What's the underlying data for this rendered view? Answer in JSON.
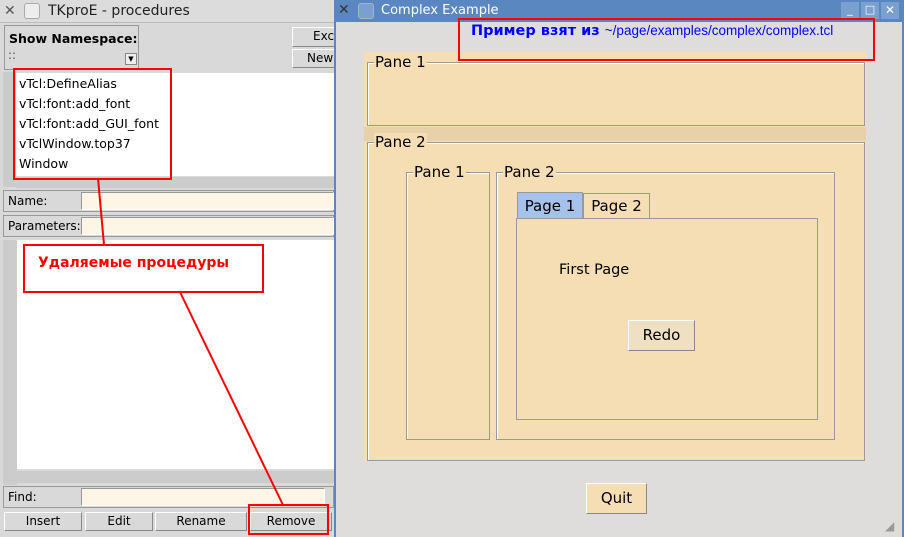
{
  "left_window": {
    "title": "TKproE - procedures",
    "namespace_label": "Show Namespace:",
    "namespace_value": "::",
    "buttons_top": [
      "Exc",
      "New"
    ],
    "procedures": [
      "vTcl:DefineAlias",
      "vTcl:font:add_font",
      "vTcl:font:add_GUI_font",
      "vTclWindow.top37",
      "Window"
    ],
    "name_label": "Name:",
    "parameters_label": "Parameters:",
    "find_label": "Find:",
    "actions": [
      "Insert",
      "Edit",
      "Rename",
      "Remove"
    ]
  },
  "right_window": {
    "title": "Complex Example",
    "pane1": "Pane 1",
    "pane2": "Pane 2",
    "inner_pane1": "Pane 1",
    "inner_pane2": "Pane 2",
    "tabs": [
      "Page 1",
      "Page 2"
    ],
    "page_text": "First Page",
    "redo": "Redo",
    "quit": "Quit"
  },
  "annotations": {
    "source_prefix": "Пример взят из ",
    "source_path": "~/page/examples/complex/complex.tcl",
    "removed": "Удаляемые процедуры"
  },
  "colors": {
    "annotation": "#ff0000",
    "tan": "#f5deb3",
    "titlebar": "#5b87c0"
  }
}
